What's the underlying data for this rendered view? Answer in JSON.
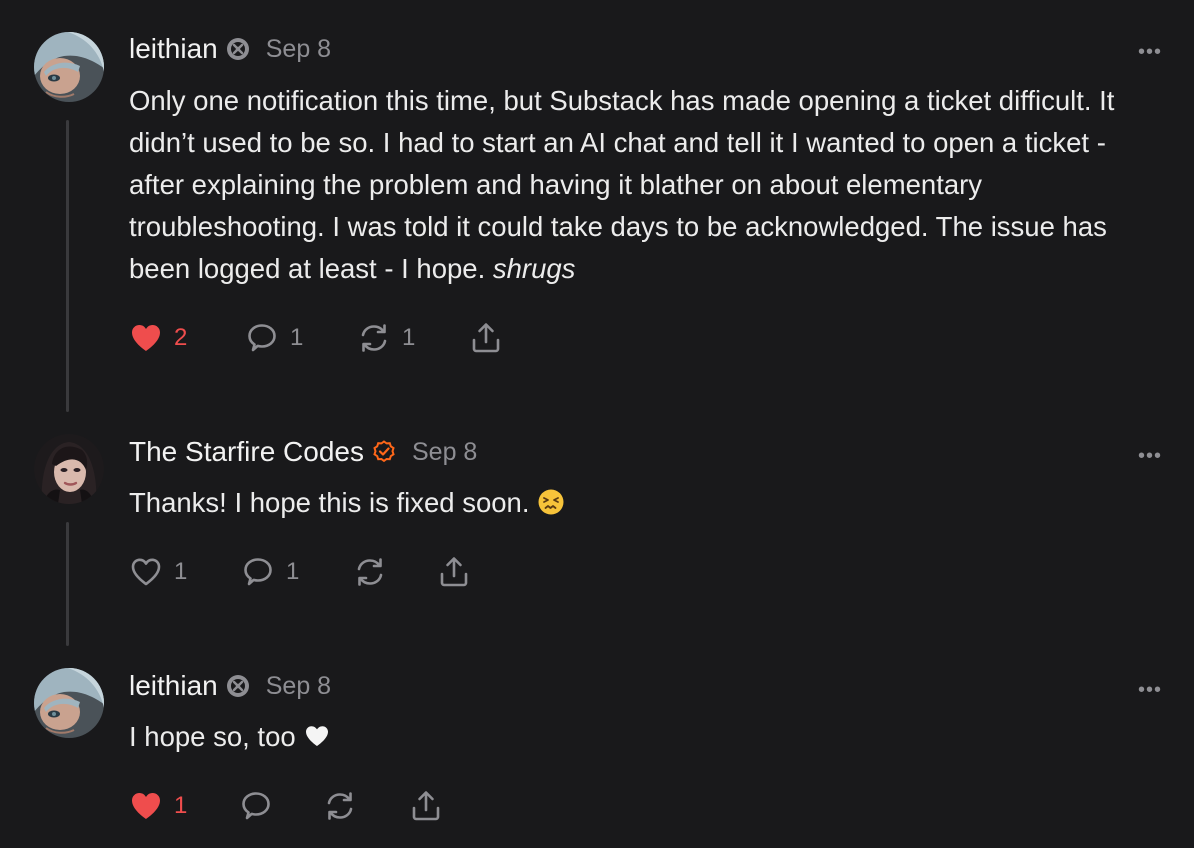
{
  "comments": [
    {
      "author": "leithian",
      "badge": "substack-badge-icon",
      "date": "Sep 8",
      "text": "Only one notification this time, but Substack has made opening a ticket difficult. It didn’t used to be so. I had to start an AI chat and tell it I wanted to open a ticket - after explaining the problem and having it blather on about elementary troubleshooting. I was told it could take days to be acknowledged. The issue has been logged at least - I hope.",
      "text_emphasis": "shrugs",
      "more_label": "•••",
      "likes": "2",
      "liked": true,
      "replies": "1",
      "restacks": "1"
    },
    {
      "author": "The Starfire Codes",
      "badge": "verified-check-icon",
      "date": "Sep 8",
      "text": "Thanks! I hope this is fixed soon.",
      "emoji": "confounded-face-emoji",
      "more_label": "•••",
      "likes": "1",
      "liked": false,
      "replies": "1",
      "restacks": ""
    },
    {
      "author": "leithian",
      "badge": "substack-badge-icon",
      "date": "Sep 8",
      "text": "I hope so, too",
      "emoji": "white-heart-emoji",
      "more_label": "•••",
      "likes": "1",
      "liked": true,
      "replies": "",
      "restacks": ""
    }
  ],
  "colors": {
    "background": "#19191b",
    "liked": "#ef4d4d",
    "muted": "#8e8e93",
    "verified": "#ff6719"
  }
}
